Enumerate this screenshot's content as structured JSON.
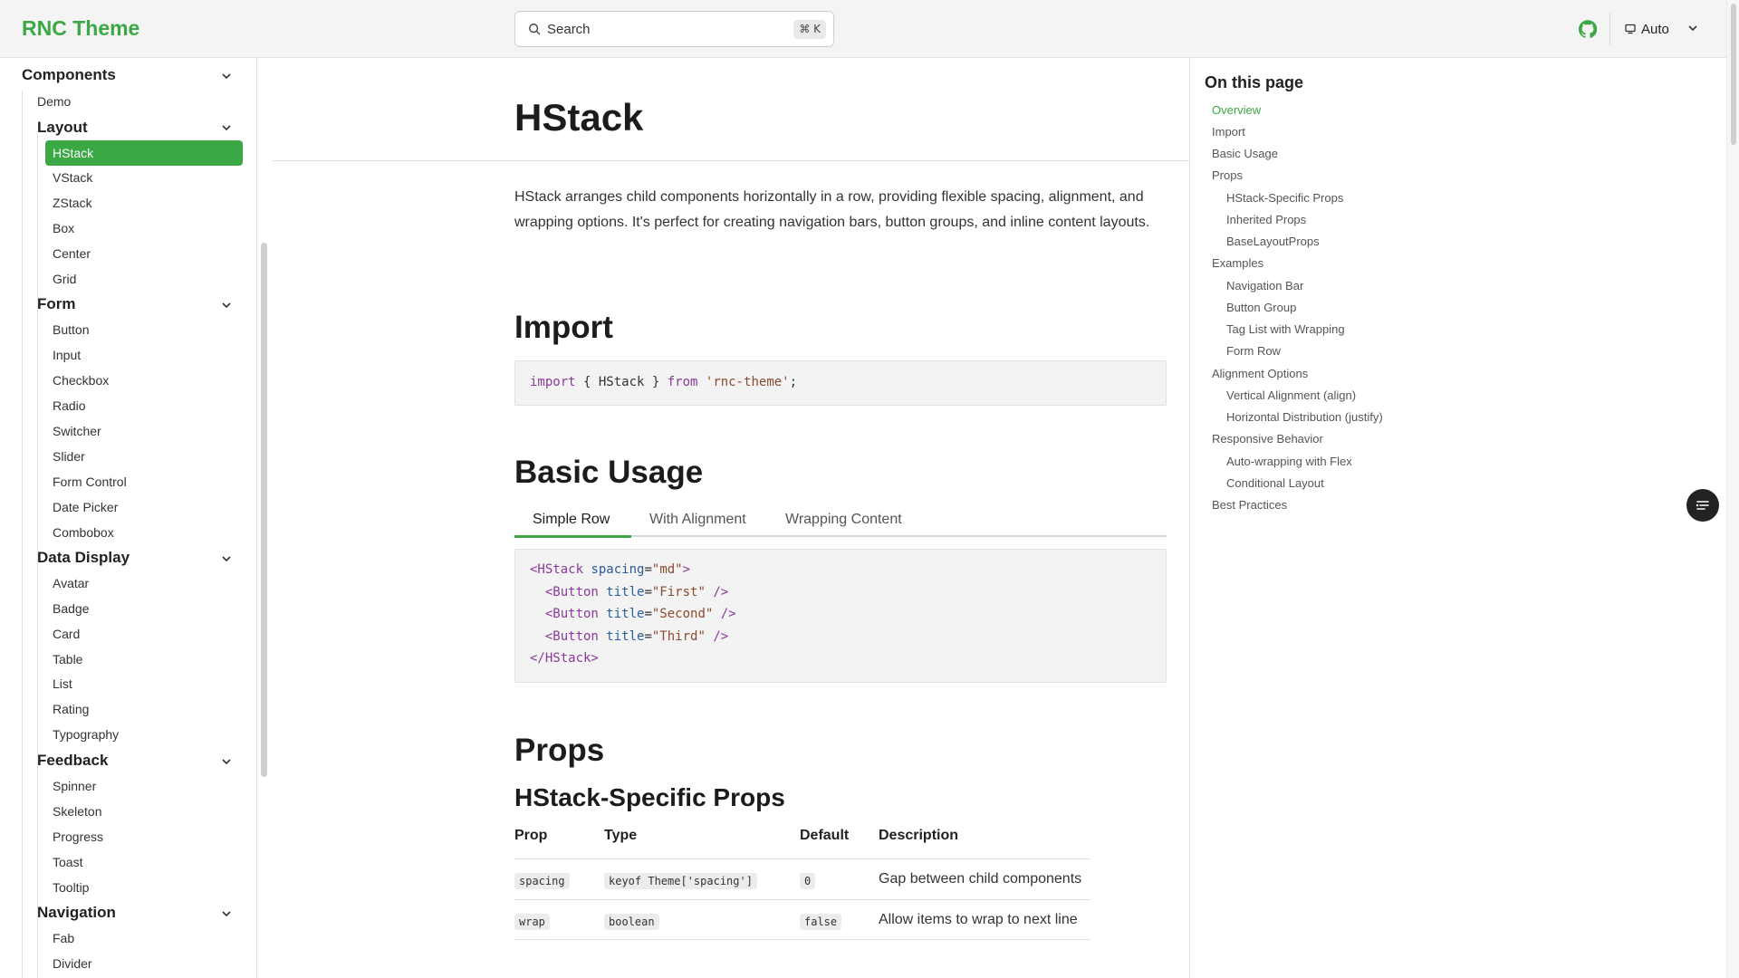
{
  "header": {
    "brand": "RNC Theme",
    "search_placeholder": "Search",
    "search_shortcut": "⌘ K",
    "theme_label": "Auto",
    "accent_color": "#3aa845"
  },
  "sidebar": {
    "components_label": "Components",
    "demo": "Demo",
    "layout": {
      "label": "Layout",
      "items": [
        "HStack",
        "VStack",
        "ZStack",
        "Box",
        "Center",
        "Grid"
      ]
    },
    "form": {
      "label": "Form",
      "items": [
        "Button",
        "Input",
        "Checkbox",
        "Radio",
        "Switcher",
        "Slider",
        "Form Control",
        "Date Picker",
        "Combobox"
      ]
    },
    "data_display": {
      "label": "Data Display",
      "items": [
        "Avatar",
        "Badge",
        "Card",
        "Table",
        "List",
        "Rating",
        "Typography"
      ]
    },
    "feedback": {
      "label": "Feedback",
      "items": [
        "Spinner",
        "Skeleton",
        "Progress",
        "Toast",
        "Tooltip"
      ]
    },
    "navigation": {
      "label": "Navigation",
      "items": [
        "Fab",
        "Divider"
      ]
    }
  },
  "main": {
    "title": "HStack",
    "intro": "HStack arranges child components horizontally in a row, providing flexible spacing, alignment, and wrapping options. It's perfect for creating navigation bars, button groups, and inline content layouts.",
    "import_heading": "Import",
    "import_code": {
      "kw1": "import",
      "mid": " { HStack } ",
      "kw2": "from",
      "str": "'rnc-theme'",
      "end": ";"
    },
    "basic_usage_heading": "Basic Usage",
    "tabs": [
      "Simple Row",
      "With Alignment",
      "Wrapping Content"
    ],
    "usage_code": {
      "line1": {
        "open": "<HStack",
        "attr": " spacing",
        "eq": "=",
        "val": "\"md\"",
        "close": ">"
      },
      "line2": {
        "open": "  <Button",
        "attr": " title",
        "eq": "=",
        "val": "\"First\"",
        "close": " />"
      },
      "line3": {
        "open": "  <Button",
        "attr": " title",
        "eq": "=",
        "val": "\"Second\"",
        "close": " />"
      },
      "line4": {
        "open": "  <Button",
        "attr": " title",
        "eq": "=",
        "val": "\"Third\"",
        "close": " />"
      },
      "line5": {
        "close": "</HStack>"
      }
    },
    "props_heading": "Props",
    "hstack_props_heading": "HStack-Specific Props",
    "table": {
      "headers": [
        "Prop",
        "Type",
        "Default",
        "Description"
      ],
      "rows": [
        {
          "prop": "spacing",
          "type": "keyof Theme['spacing']",
          "default": "0",
          "description": "Gap between child components"
        },
        {
          "prop": "wrap",
          "type": "boolean",
          "default": "false",
          "description": "Allow items to wrap to next line"
        }
      ]
    }
  },
  "toc": {
    "title": "On this page",
    "items": [
      {
        "label": "Overview",
        "level": 1,
        "active": true
      },
      {
        "label": "Import",
        "level": 1
      },
      {
        "label": "Basic Usage",
        "level": 1
      },
      {
        "label": "Props",
        "level": 1
      },
      {
        "label": "HStack-Specific Props",
        "level": 2
      },
      {
        "label": "Inherited Props",
        "level": 2
      },
      {
        "label": "BaseLayoutProps",
        "level": 2
      },
      {
        "label": "Examples",
        "level": 1
      },
      {
        "label": "Navigation Bar",
        "level": 2
      },
      {
        "label": "Button Group",
        "level": 2
      },
      {
        "label": "Tag List with Wrapping",
        "level": 2
      },
      {
        "label": "Form Row",
        "level": 2
      },
      {
        "label": "Alignment Options",
        "level": 1
      },
      {
        "label": "Vertical Alignment (align)",
        "level": 2
      },
      {
        "label": "Horizontal Distribution (justify)",
        "level": 2
      },
      {
        "label": "Responsive Behavior",
        "level": 1
      },
      {
        "label": "Auto-wrapping with Flex",
        "level": 2
      },
      {
        "label": "Conditional Layout",
        "level": 2
      },
      {
        "label": "Best Practices",
        "level": 1
      }
    ]
  }
}
